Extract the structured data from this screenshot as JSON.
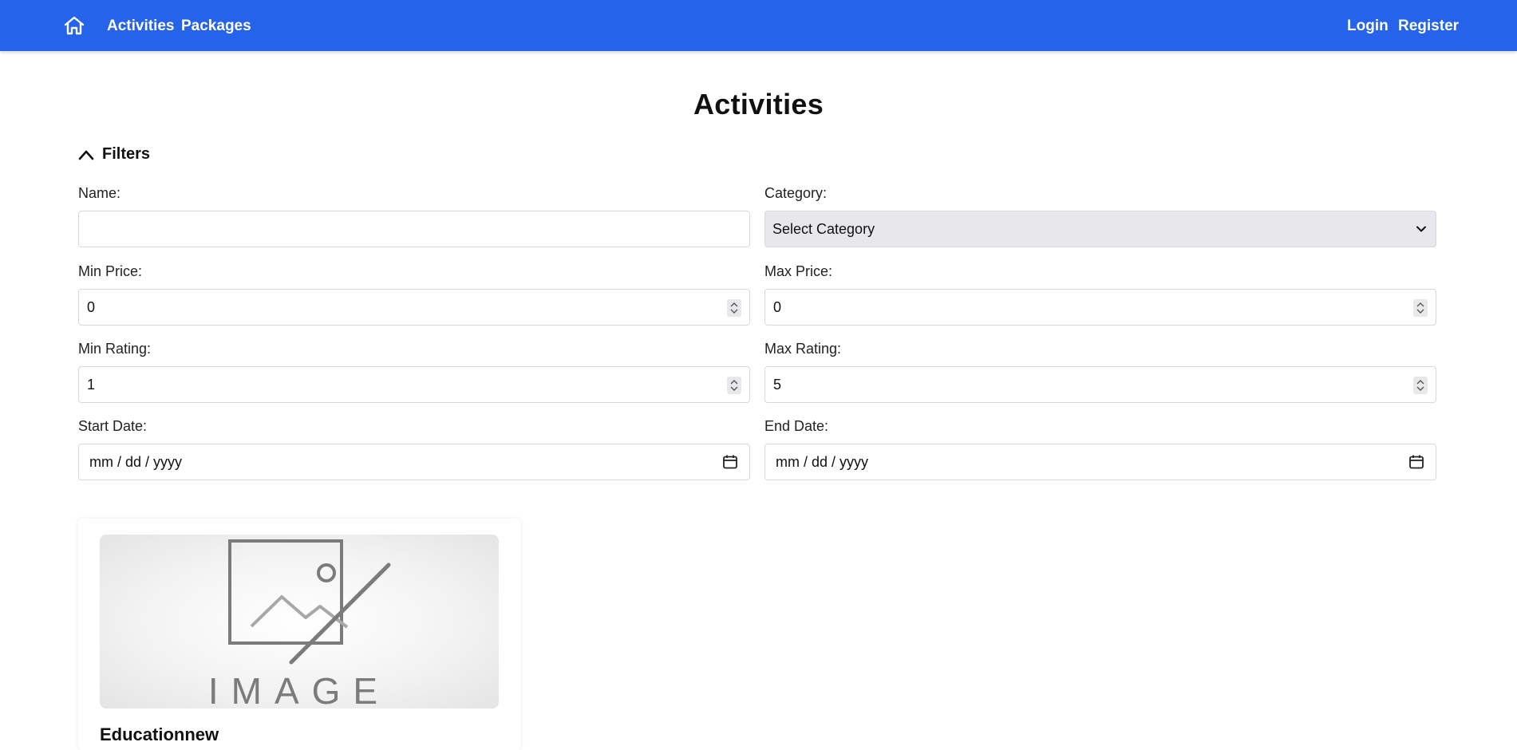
{
  "nav": {
    "home_icon": "home-icon",
    "links": [
      "Activities",
      "Packages"
    ],
    "auth": [
      "Login",
      "Register"
    ]
  },
  "page": {
    "title": "Activities"
  },
  "filters": {
    "toggle_label": "Filters",
    "name": {
      "label": "Name:",
      "value": ""
    },
    "category": {
      "label": "Category:",
      "value": "Select Category"
    },
    "min_price": {
      "label": "Min Price:",
      "value": "0"
    },
    "max_price": {
      "label": "Max Price:",
      "value": "0"
    },
    "min_rating": {
      "label": "Min Rating:",
      "value": "1"
    },
    "max_rating": {
      "label": "Max Rating:",
      "value": "5"
    },
    "start_date": {
      "label": "Start Date:",
      "placeholder": "mm / dd / yyyy"
    },
    "end_date": {
      "label": "End Date:",
      "placeholder": "mm / dd / yyyy"
    }
  },
  "card": {
    "image_text": "IMAGE",
    "title": "Educationnew"
  },
  "colors": {
    "primary": "#2563eb",
    "select_bg": "#e8e8ec"
  }
}
